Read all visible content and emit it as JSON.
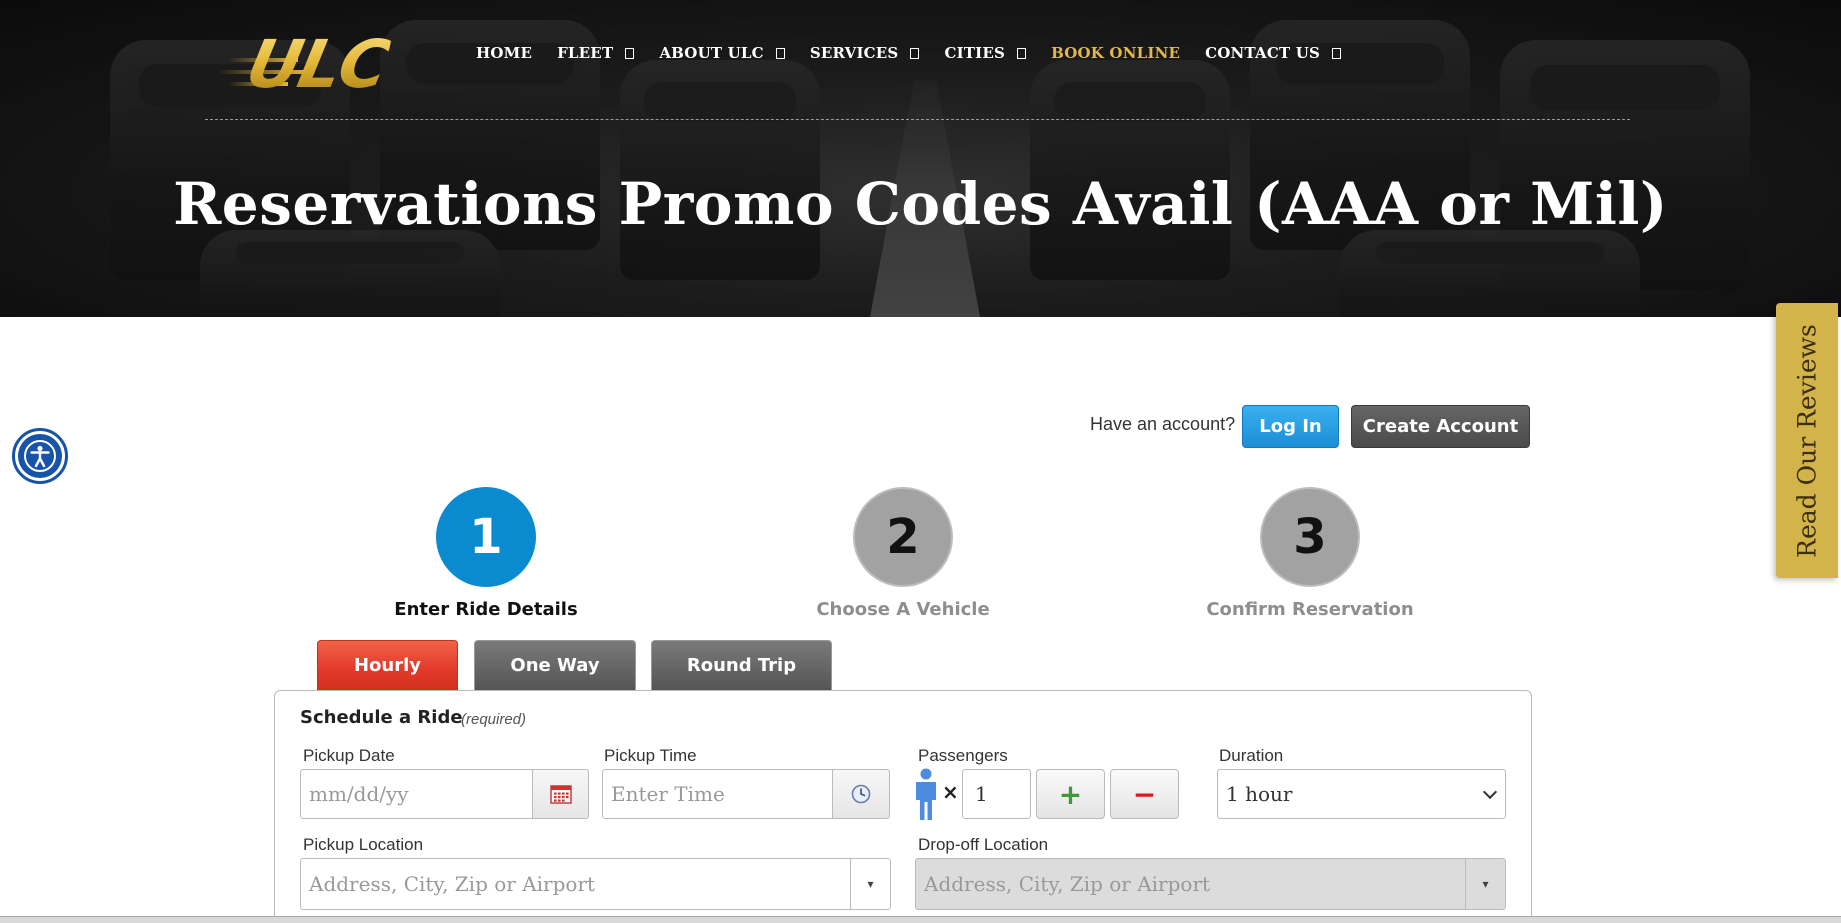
{
  "brand": {
    "logo_text": "ULC",
    "gold": "#e4b93a"
  },
  "nav": {
    "items": [
      {
        "label": "HOME",
        "has_submenu": false
      },
      {
        "label": "FLEET",
        "has_submenu": true
      },
      {
        "label": "ABOUT ULC",
        "has_submenu": true
      },
      {
        "label": "SERVICES",
        "has_submenu": true
      },
      {
        "label": "CITIES",
        "has_submenu": true
      },
      {
        "label": "BOOK ONLINE",
        "has_submenu": false,
        "active": true
      },
      {
        "label": "CONTACT US",
        "has_submenu": true
      }
    ]
  },
  "hero": {
    "title": "Reservations Promo Codes Avail (AAA or Mil)"
  },
  "side_tab": {
    "label": "Read Our Reviews",
    "color": "#d2b44b"
  },
  "accessibility": {
    "icon": "accessibility-icon"
  },
  "account": {
    "question": "Have an account?",
    "login_label": "Log In",
    "create_label": "Create Account"
  },
  "steps": [
    {
      "number": "1",
      "label": "Enter Ride Details",
      "active": true
    },
    {
      "number": "2",
      "label": "Choose A Vehicle",
      "active": false
    },
    {
      "number": "3",
      "label": "Confirm Reservation",
      "active": false
    }
  ],
  "tabs": [
    {
      "label": "Hourly",
      "active": true
    },
    {
      "label": "One Way",
      "active": false
    },
    {
      "label": "Round Trip",
      "active": false
    }
  ],
  "form": {
    "title": "Schedule a Ride",
    "required_note": "(required)",
    "pickup_date": {
      "label": "Pickup Date",
      "placeholder": "mm/dd/yy"
    },
    "pickup_time": {
      "label": "Pickup Time",
      "placeholder": "Enter Time"
    },
    "passengers": {
      "label": "Passengers",
      "value": "1",
      "times": "×",
      "plus": "+",
      "minus": "−"
    },
    "duration": {
      "label": "Duration",
      "value": "1 hour"
    },
    "pickup_location": {
      "label": "Pickup Location",
      "placeholder": "Address, City, Zip or Airport"
    },
    "dropoff_location": {
      "label": "Drop-off Location",
      "placeholder": "Address, City, Zip or Airport"
    },
    "dropdown_glyph": "▾"
  },
  "colors": {
    "primary_blue": "#0a8bd0",
    "tab_red": "#e1392a",
    "inactive_gray": "#a2a2a2"
  }
}
